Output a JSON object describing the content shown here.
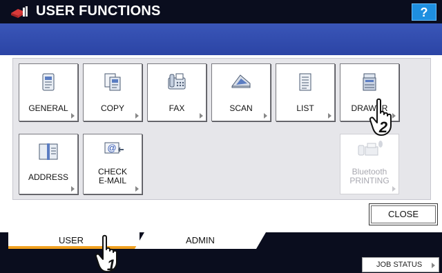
{
  "header": {
    "title": "USER FUNCTIONS",
    "help_label": "?"
  },
  "functions": {
    "general": "GENERAL",
    "copy": "COPY",
    "fax": "FAX",
    "scan": "SCAN",
    "list": "LIST",
    "drawer": "DRAWER",
    "address": "ADDRESS",
    "check_email_line1": "CHECK",
    "check_email_line2": "E-MAIL",
    "bluetooth_line1": "Bluetooth",
    "bluetooth_line2": "PRINTING"
  },
  "close_label": "CLOSE",
  "tabs": {
    "user": "USER",
    "admin": "ADMIN"
  },
  "job_status_label": "JOB STATUS",
  "callouts": {
    "step1": "1",
    "step2": "2"
  },
  "colors": {
    "title_bar": "#0a0d1e",
    "blue_bar": "#2b44a5",
    "help_button": "#1e8fe0",
    "active_tab_underline": "#f0a020"
  }
}
